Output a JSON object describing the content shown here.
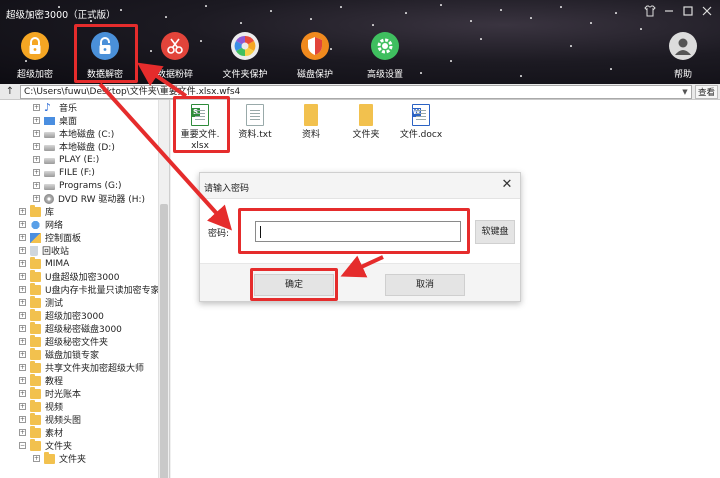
{
  "window": {
    "title": "超级加密3000（正式版）",
    "controls": [
      "shirt-icon",
      "minimize-icon",
      "maximize-icon",
      "close-icon"
    ]
  },
  "toolbar": {
    "items": [
      {
        "label": "超级加密",
        "icon": "lock-icon",
        "color": "#f5a623"
      },
      {
        "label": "数据解密",
        "icon": "unlock-icon",
        "color": "#4a90d9"
      },
      {
        "label": "数据粉碎",
        "icon": "scissors-icon",
        "color": "#e2443a"
      },
      {
        "label": "文件夹保护",
        "icon": "aperture-icon",
        "color": "#ececec"
      },
      {
        "label": "磁盘保护",
        "icon": "shield-icon",
        "color": "#f08a1e"
      },
      {
        "label": "高级设置",
        "icon": "gear-icon",
        "color": "#3fbf5f"
      }
    ],
    "help": {
      "label": "帮助",
      "icon": "user-help-icon",
      "color": "#dcdcdc"
    }
  },
  "pathbar": {
    "up": "↑",
    "path": "C:\\Users\\fuwu\\Desktop\\文件夹\\重要文件.xlsx.wfs4",
    "view_label": "查看"
  },
  "tree": {
    "items": [
      {
        "label": "音乐",
        "icon": "music-icon",
        "depth": 2
      },
      {
        "label": "桌面",
        "icon": "desktop-icon",
        "depth": 2
      },
      {
        "label": "本地磁盘 (C:)",
        "icon": "drive-icon",
        "depth": 2
      },
      {
        "label": "本地磁盘 (D:)",
        "icon": "drive-icon",
        "depth": 2
      },
      {
        "label": "PLAY (E:)",
        "icon": "drive-icon",
        "depth": 2
      },
      {
        "label": "FILE (F:)",
        "icon": "drive-icon",
        "depth": 2
      },
      {
        "label": "Programs (G:)",
        "icon": "drive-icon",
        "depth": 2
      },
      {
        "label": "DVD RW 驱动器 (H:)",
        "icon": "dvd-icon",
        "depth": 2
      },
      {
        "label": "库",
        "icon": "folder-icon",
        "depth": 1
      },
      {
        "label": "网络",
        "icon": "network-icon",
        "depth": 1
      },
      {
        "label": "控制面板",
        "icon": "control-panel-icon",
        "depth": 1
      },
      {
        "label": "回收站",
        "icon": "recycle-bin-icon",
        "depth": 1
      },
      {
        "label": "MIMA",
        "icon": "folder-icon",
        "depth": 1
      },
      {
        "label": "U盘超级加密3000",
        "icon": "folder-icon",
        "depth": 1
      },
      {
        "label": "U盘内存卡批量只读加密专家",
        "icon": "folder-icon",
        "depth": 1
      },
      {
        "label": "测试",
        "icon": "folder-icon",
        "depth": 1
      },
      {
        "label": "超级加密3000",
        "icon": "folder-icon",
        "depth": 1
      },
      {
        "label": "超级秘密磁盘3000",
        "icon": "folder-icon",
        "depth": 1
      },
      {
        "label": "超级秘密文件夹",
        "icon": "folder-icon",
        "depth": 1
      },
      {
        "label": "磁盘加锁专家",
        "icon": "folder-icon",
        "depth": 1
      },
      {
        "label": "共享文件夹加密超级大师",
        "icon": "folder-icon",
        "depth": 1
      },
      {
        "label": "教程",
        "icon": "folder-icon",
        "depth": 1
      },
      {
        "label": "时光账本",
        "icon": "folder-icon",
        "depth": 1
      },
      {
        "label": "视频",
        "icon": "folder-icon",
        "depth": 1
      },
      {
        "label": "视频头图",
        "icon": "folder-icon",
        "depth": 1
      },
      {
        "label": "素材",
        "icon": "folder-icon",
        "depth": 1
      },
      {
        "label": "文件夹",
        "icon": "folder-icon",
        "depth": 1
      },
      {
        "label": "文件夹",
        "icon": "folder-icon",
        "depth": 2
      }
    ]
  },
  "files": [
    {
      "name": "重要文件.\nxlsx",
      "icon": "excel-file-icon"
    },
    {
      "name": "资料.txt",
      "icon": "text-file-icon"
    },
    {
      "name": "资料",
      "icon": "folder-icon"
    },
    {
      "name": "文件夹",
      "icon": "folder-icon"
    },
    {
      "name": "文件.docx",
      "icon": "word-file-icon"
    }
  ],
  "dialog": {
    "title": "请输入密码",
    "password_label": "密码:",
    "password_value": "",
    "keyboard_button": "软键盘",
    "ok_button": "确定",
    "cancel_button": "取消"
  },
  "colors": {
    "annotation": "#e52c2c",
    "folder": "#f2c14e",
    "excel": "#2e8b3a",
    "word": "#2b62c4"
  }
}
